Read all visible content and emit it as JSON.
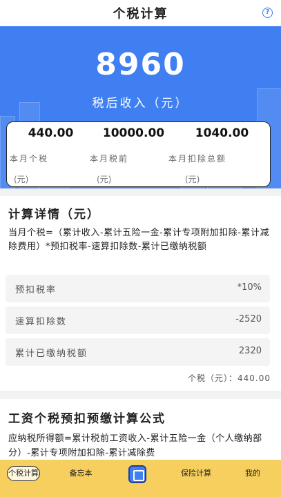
{
  "header": {
    "title": "个税计算",
    "help_icon": "question-circle-icon",
    "help_label": "?"
  },
  "hero": {
    "amount": "8960",
    "caption": "税后收入（元）"
  },
  "summary": {
    "items": [
      {
        "value": "440.00",
        "label": "本月个税",
        "unit": "(元)"
      },
      {
        "value": "10000.00",
        "label": "本月税前",
        "unit": "(元)"
      },
      {
        "value": "1040.00",
        "label": "本月扣除总额",
        "unit": "(元)"
      }
    ]
  },
  "details": {
    "title": "计算详情（元）",
    "formula": "当月个税=（累计收入-累计五险一金-累计专项附加扣除-累计减除费用）*预扣税率-速算扣除数-累计已缴纳税额",
    "rows": [
      {
        "label": "预扣税率",
        "value": "*10%"
      },
      {
        "label": "速算扣除数",
        "value": "-2520"
      },
      {
        "label": "累计已缴纳税额",
        "value": "2320"
      }
    ],
    "total": "个税（元）：440.00"
  },
  "formula_card": {
    "title": "工资个税预扣预缴计算公式",
    "text": "应纳税所得额=累计税前工资收入-累计五险一金（个人缴纳部分）-累计专项附加扣除-累计减除费"
  },
  "tabbar": {
    "tabs": [
      {
        "label": "个税计算"
      },
      {
        "label": "备忘本"
      },
      {
        "label": ""
      },
      {
        "label": "保险计算"
      },
      {
        "label": "我的"
      }
    ]
  },
  "colors": {
    "primary": "#3f7ff2",
    "tabbar": "#f7cf5e"
  }
}
